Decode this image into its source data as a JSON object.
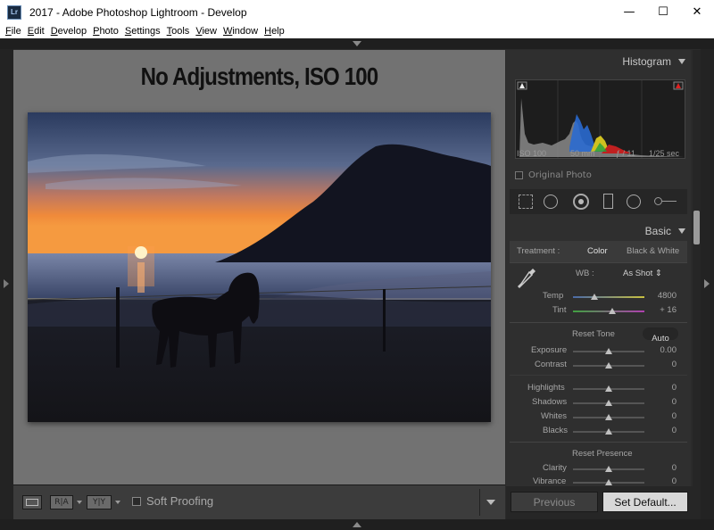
{
  "window": {
    "title": "2017 - Adobe Photoshop Lightroom - Develop",
    "app_icon": "Lr",
    "minimize": "—",
    "maximize": "☐",
    "close": "✕"
  },
  "menu": [
    "File",
    "Edit",
    "Develop",
    "Photo",
    "Settings",
    "Tools",
    "View",
    "Window",
    "Help"
  ],
  "overlay": {
    "title": "No Adjustments, ISO 100"
  },
  "toolbar": {
    "soft_proofing": "Soft Proofing",
    "compare_ra": "R|A",
    "compare_yy": "Y|Y"
  },
  "histogram": {
    "header": "Histogram",
    "iso": "ISO 100",
    "focal": "50 mm",
    "aperture": "ƒ / 11",
    "shutter": "1/25 sec",
    "original_photo": "Original Photo"
  },
  "basic": {
    "header": "Basic",
    "treatment_label": "Treatment :",
    "treatment_color": "Color",
    "treatment_bw": "Black & White",
    "wb_label": "WB :",
    "wb_value": "As Shot ⇕",
    "temp_label": "Temp",
    "temp_value": "4800",
    "temp_level": 0.3,
    "tint_label": "Tint",
    "tint_value": "+ 16",
    "tint_level": 0.55,
    "reset_tone": "Reset Tone",
    "auto": "Auto",
    "exposure_label": "Exposure",
    "exposure_value": "0.00",
    "contrast_label": "Contrast",
    "contrast_value": "0",
    "highlights_label": "Highlights",
    "highlights_value": "0",
    "shadows_label": "Shadows",
    "shadows_value": "0",
    "whites_label": "Whites",
    "whites_value": "0",
    "blacks_label": "Blacks",
    "blacks_value": "0",
    "reset_presence": "Reset Presence",
    "clarity_label": "Clarity",
    "clarity_value": "0",
    "vibrance_label": "Vibrance",
    "vibrance_value": "0"
  },
  "bottom_buttons": {
    "previous": "Previous",
    "set_default": "Set Default..."
  },
  "colors": {
    "panel_bg": "#2f2f2f",
    "canvas_bg": "#727272",
    "accent_text": "#c8c8c8"
  }
}
